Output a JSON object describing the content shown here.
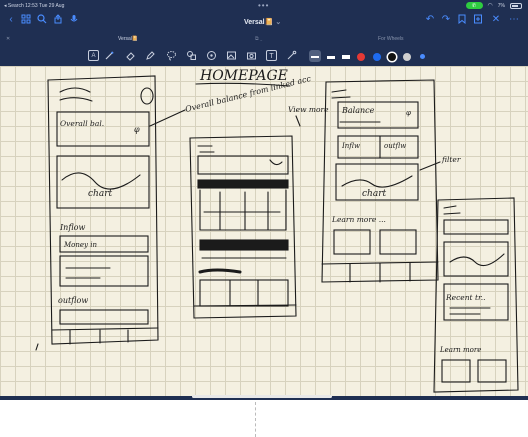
{
  "status_bar": {
    "back_label": "◂ Search",
    "time": "12:53",
    "date": "Tue 29 Aug",
    "battery": "7%"
  },
  "toolbar": {
    "title": "Versal📔",
    "title_chevron": "⌄",
    "icons": [
      "back-icon",
      "grid-icon",
      "search-icon",
      "share-icon",
      "mic-icon",
      "undo-icon",
      "redo-icon",
      "bookmark-icon",
      "add-page-icon",
      "close-icon",
      "more-icon"
    ]
  },
  "tabs": [
    {
      "label": "Versal📔"
    },
    {
      "label": "For Wheels"
    }
  ],
  "pen_tools": {
    "icons": [
      "text-mode-icon",
      "pen-icon",
      "eraser-icon",
      "highlighter-icon",
      "lasso-icon",
      "shapes-icon",
      "sticker-icon",
      "image-icon",
      "camera-icon",
      "textbox-icon",
      "laser-icon"
    ],
    "colors": [
      "#ffffff",
      "#ffffff",
      "#e53935",
      "#1e6bf0",
      "#111111",
      "#cfcfcf"
    ]
  },
  "sketch": {
    "title": "HOMEPAGE",
    "overall_note": "Overall balance from linked acc",
    "view_more": "View more",
    "filter": "filter",
    "lane1": {
      "overall": "Overall bal.",
      "chart": "chart",
      "inflow": "Inflow",
      "money_in": "Money in",
      "outflow": "outflow"
    },
    "lane3": {
      "balance": "Balance",
      "inflow": "Inflw",
      "outflow": "outflw",
      "chart": "chart",
      "learn_more": "Learn more ..."
    },
    "lane4": {
      "recent": "Recent tr..",
      "learn_more": "Learn more"
    }
  }
}
